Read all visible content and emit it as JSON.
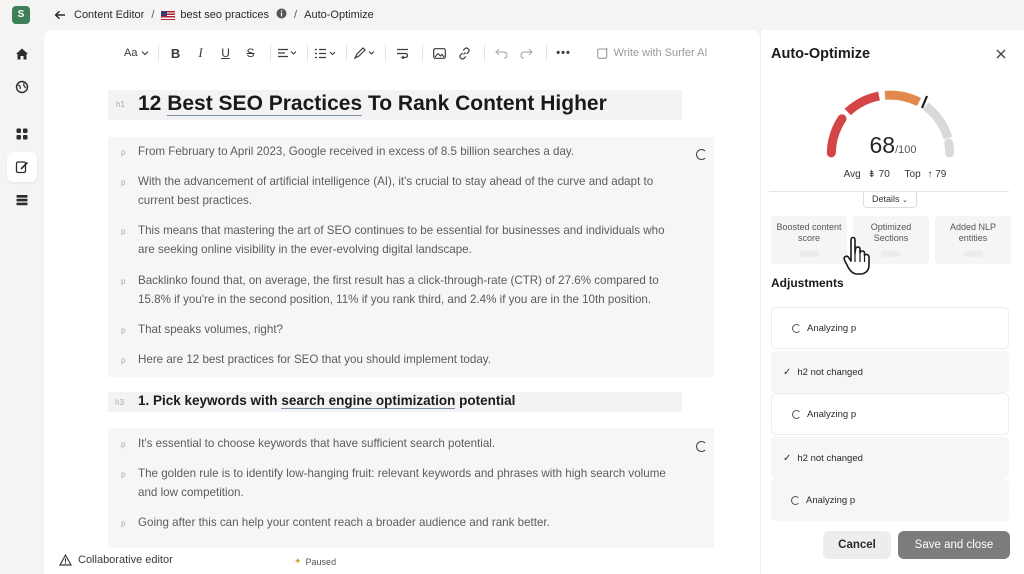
{
  "app": {
    "logo_letter": "S"
  },
  "breadcrumb": {
    "items": [
      "Content Editor",
      "best seo practices",
      "Auto-Optimize"
    ]
  },
  "toolbar": {
    "font_label": "Aa",
    "ai_label": "Write with Surfer AI"
  },
  "document": {
    "h1": {
      "tag": "h1",
      "pre": "12 ",
      "linked": "Best SEO Practices",
      "post": " To Rank Content Higher"
    },
    "paragraphs_1": [
      "From February to April 2023, Google received in excess of 8.5 billion searches a day.",
      "With the advancement of artificial intelligence (AI), it's crucial to stay ahead of the curve and adapt to current best practices.",
      "This means that mastering the art of SEO continues to be essential for businesses and individuals who are seeking online visibility in the ever-evolving digital landscape.",
      "Backlinko found that, on average, the first result has a click-through-rate (CTR) of 27.6% compared to 15.8% if you're in the second position, 11% if you rank third, and 2.4% if you are in the 10th position.",
      "That speaks volumes, right?",
      "Here are 12 best practices for SEO that you should implement today."
    ],
    "h3": {
      "tag": "h3",
      "pre": "1. Pick keywords with ",
      "linked": "search engine optimization",
      "post": " potential"
    },
    "paragraphs_2": [
      "It's essential to choose keywords that have sufficient search potential.",
      "The golden rule is to identify low-hanging fruit: relevant keywords and phrases with high search volume and low competition.",
      "Going after this can help your content reach a broader audience and rank better."
    ],
    "p_tag": "p"
  },
  "statusbar": {
    "collab": "Collaborative editor",
    "paused": "Paused"
  },
  "panel": {
    "title": "Auto-Optimize",
    "score": "68",
    "score_max": "/100",
    "avg_label": "Avg",
    "avg_value": "70",
    "top_label": "Top",
    "top_value": "79",
    "details_label": "Details",
    "metrics": [
      "Boosted content score",
      "Optimized Sections",
      "Added NLP entities"
    ],
    "adjustments_title": "Adjustments",
    "adjustments": [
      {
        "status": "analyzing",
        "label": "Analyzing p"
      },
      {
        "status": "done",
        "label": "h2 not changed"
      },
      {
        "status": "analyzing",
        "label": "Analyzing p"
      },
      {
        "status": "done",
        "label": "h2 not changed"
      },
      {
        "status": "analyzing",
        "label": "Analyzing p"
      }
    ],
    "cancel_label": "Cancel",
    "save_label": "Save and close"
  },
  "colors": {
    "gauge_red": "#d64545",
    "gauge_orange": "#e0894a",
    "gauge_gray": "#d9d9d9",
    "brand_green": "#3f7f57"
  }
}
